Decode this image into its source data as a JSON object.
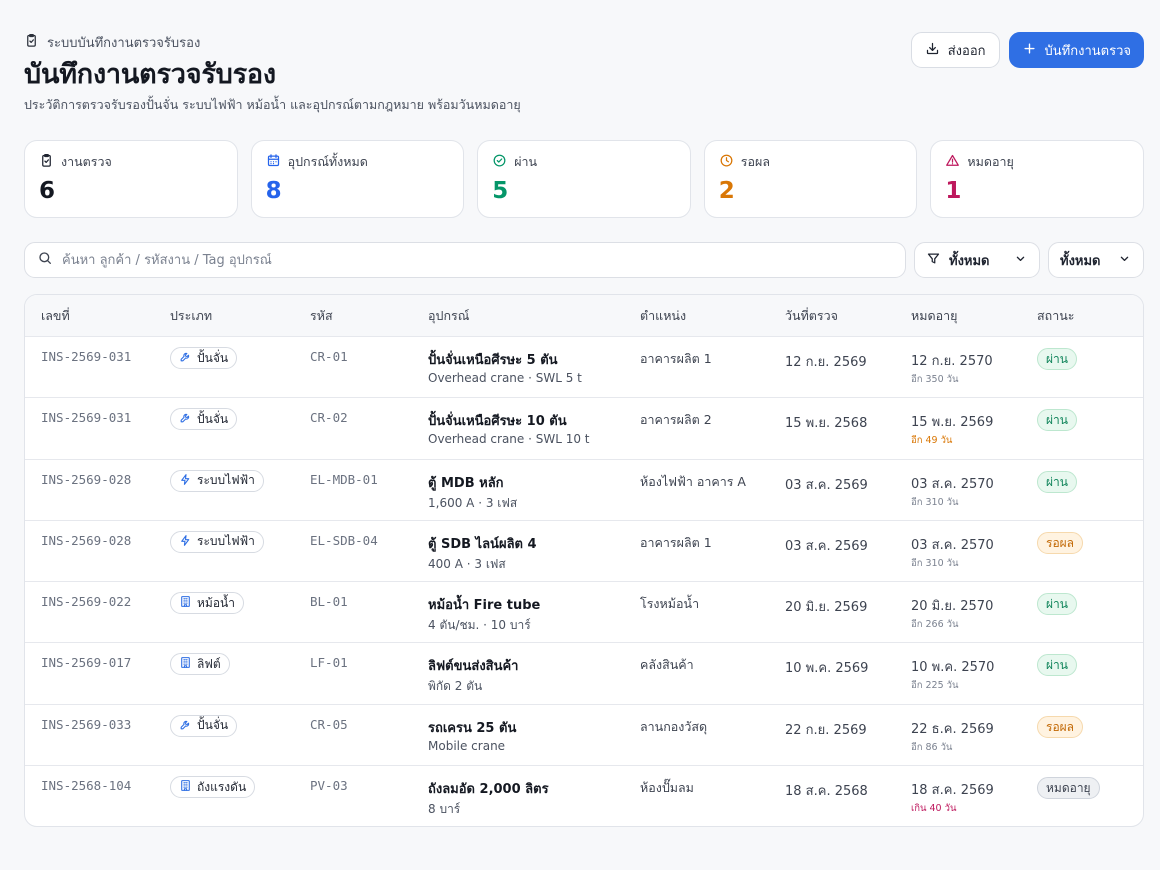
{
  "header": {
    "breadcrumb": "ระบบบันทึกงานตรวจรับรอง",
    "title": "บันทึกงานตรวจรับรอง",
    "subtitle": "ประวัติการตรวจรับรองปั้นจั่น ระบบไฟฟ้า หม้อน้ำ และอุปกรณ์ตามกฎหมาย พร้อมวันหมดอายุ",
    "export_label": "ส่งออก",
    "new_label": "บันทึกงานตรวจ"
  },
  "stats": [
    {
      "label": "งานตรวจ",
      "value": "6",
      "color": "#141821",
      "icon": "clipboard-icon"
    },
    {
      "label": "อุปกรณ์ทั้งหมด",
      "value": "8",
      "color": "#2563eb",
      "icon": "calendar-icon"
    },
    {
      "label": "ผ่าน",
      "value": "5",
      "color": "#059669",
      "icon": "check-circle-icon"
    },
    {
      "label": "รอผล",
      "value": "2",
      "color": "#d97706",
      "icon": "clock-icon"
    },
    {
      "label": "หมดอายุ",
      "value": "1",
      "color": "#be185d",
      "icon": "warning-icon"
    }
  ],
  "search": {
    "placeholder": "ค้นหา ลูกค้า / รหัสงาน / Tag อุปกรณ์",
    "filter1": "ทั้งหมด",
    "filter2": "ทั้งหมด"
  },
  "table": {
    "headers": [
      "เลขที่",
      "ประเภท",
      "รหัส",
      "อุปกรณ์",
      "ตำแหน่ง",
      "วันที่ตรวจ",
      "หมดอายุ",
      "สถานะ"
    ],
    "rows": [
      {
        "no": "INS-2569-031",
        "type": "ปั้นจั่น",
        "type_icon": "wrench-icon",
        "code": "CR-01",
        "name": "ปั้นจั่นเหนือศีรษะ 5 ตัน",
        "detail": "Overhead crane · SWL 5 t",
        "location": "อาคารผลิต 1",
        "inspected": "12 ก.ย. 2569",
        "expires": "12 ก.ย. 2570",
        "remaining": "อีก 350 วัน",
        "remaining_color": "#7b8290",
        "status": "ผ่าน",
        "status_kind": "pass"
      },
      {
        "no": "INS-2569-031",
        "type": "ปั้นจั่น",
        "type_icon": "wrench-icon",
        "code": "CR-02",
        "name": "ปั้นจั่นเหนือศีรษะ 10 ตัน",
        "detail": "Overhead crane · SWL 10 t",
        "location": "อาคารผลิต 2",
        "inspected": "15 พ.ย. 2568",
        "expires": "15 พ.ย. 2569",
        "remaining": "อีก 49 วัน",
        "remaining_color": "#d97706",
        "status": "ผ่าน",
        "status_kind": "pass"
      },
      {
        "no": "INS-2569-028",
        "type": "ระบบไฟฟ้า",
        "type_icon": "bolt-icon",
        "code": "EL-MDB-01",
        "name": "ตู้ MDB หลัก",
        "detail": "1,600 A · 3 เฟส",
        "location": "ห้องไฟฟ้า อาคาร A",
        "inspected": "03 ส.ค. 2569",
        "expires": "03 ส.ค. 2570",
        "remaining": "อีก 310 วัน",
        "remaining_color": "#7b8290",
        "status": "ผ่าน",
        "status_kind": "pass"
      },
      {
        "no": "INS-2569-028",
        "type": "ระบบไฟฟ้า",
        "type_icon": "bolt-icon",
        "code": "EL-SDB-04",
        "name": "ตู้ SDB ไลน์ผลิต 4",
        "detail": "400 A · 3 เฟส",
        "location": "อาคารผลิต 1",
        "inspected": "03 ส.ค. 2569",
        "expires": "03 ส.ค. 2570",
        "remaining": "อีก 310 วัน",
        "remaining_color": "#7b8290",
        "status": "รอผล",
        "status_kind": "wait"
      },
      {
        "no": "INS-2569-022",
        "type": "หม้อน้ำ",
        "type_icon": "building-icon",
        "code": "BL-01",
        "name": "หม้อน้ำ Fire tube",
        "detail": "4 ตัน/ชม. · 10 บาร์",
        "location": "โรงหม้อน้ำ",
        "inspected": "20 มิ.ย. 2569",
        "expires": "20 มิ.ย. 2570",
        "remaining": "อีก 266 วัน",
        "remaining_color": "#7b8290",
        "status": "ผ่าน",
        "status_kind": "pass"
      },
      {
        "no": "INS-2569-017",
        "type": "ลิฟต์",
        "type_icon": "building-icon",
        "code": "LF-01",
        "name": "ลิฟต์ขนส่งสินค้า",
        "detail": "พิกัด 2 ตัน",
        "location": "คลังสินค้า",
        "inspected": "10 พ.ค. 2569",
        "expires": "10 พ.ค. 2570",
        "remaining": "อีก 225 วัน",
        "remaining_color": "#7b8290",
        "status": "ผ่าน",
        "status_kind": "pass"
      },
      {
        "no": "INS-2569-033",
        "type": "ปั้นจั่น",
        "type_icon": "wrench-icon",
        "code": "CR-05",
        "name": "รถเครน 25 ตัน",
        "detail": "Mobile crane",
        "location": "ลานกองวัสดุ",
        "inspected": "22 ก.ย. 2569",
        "expires": "22 ธ.ค. 2569",
        "remaining": "อีก 86 วัน",
        "remaining_color": "#7b8290",
        "status": "รอผล",
        "status_kind": "wait"
      },
      {
        "no": "INS-2568-104",
        "type": "ถังแรงดัน",
        "type_icon": "building-icon",
        "code": "PV-03",
        "name": "ถังลมอัด 2,000 ลิตร",
        "detail": "8 บาร์",
        "location": "ห้องปั๊มลม",
        "inspected": "18 ส.ค. 2568",
        "expires": "18 ส.ค. 2569",
        "remaining": "เกิน 40 วัน",
        "remaining_color": "#be185d",
        "status": "หมดอายุ",
        "status_kind": "exp"
      }
    ]
  },
  "colors": {
    "primary": "#2f6fe4",
    "pass": "#10845a",
    "wait": "#c36a07",
    "expired": "#be185d"
  }
}
